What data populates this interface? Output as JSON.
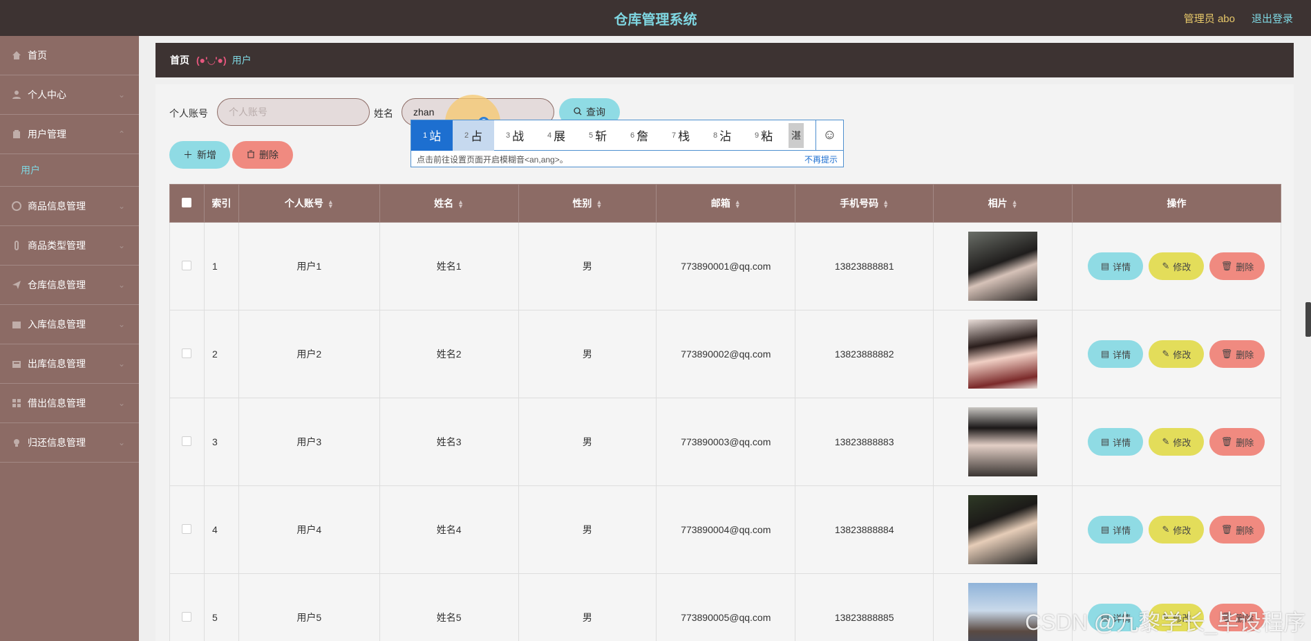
{
  "header": {
    "title": "仓库管理系统",
    "admin": "管理员 abo",
    "logout": "退出登录"
  },
  "sidebar": {
    "items": [
      {
        "label": "首页",
        "icon": "home-icon"
      },
      {
        "label": "个人中心",
        "icon": "user-icon"
      },
      {
        "label": "用户管理",
        "icon": "building-icon"
      },
      {
        "label": "商品信息管理",
        "icon": "tag-icon"
      },
      {
        "label": "商品类型管理",
        "icon": "clip-icon"
      },
      {
        "label": "仓库信息管理",
        "icon": "send-icon"
      },
      {
        "label": "入库信息管理",
        "icon": "box-icon"
      },
      {
        "label": "出库信息管理",
        "icon": "box-out-icon"
      },
      {
        "label": "借出信息管理",
        "icon": "grid-icon"
      },
      {
        "label": "归还信息管理",
        "icon": "bulb-icon"
      }
    ],
    "sub_active": "用户"
  },
  "breadcrumb": {
    "home": "首页",
    "face": "(●'◡'●)",
    "current": "用户"
  },
  "search": {
    "account_label": "个人账号",
    "account_placeholder": "个人账号",
    "name_label": "姓名",
    "name_value": "zhan",
    "query_button": "查询"
  },
  "actions": {
    "add": "新增",
    "delete": "删除"
  },
  "ime": {
    "candidates": [
      {
        "n": "1",
        "t": "站"
      },
      {
        "n": "2",
        "t": "占"
      },
      {
        "n": "3",
        "t": "战"
      },
      {
        "n": "4",
        "t": "展"
      },
      {
        "n": "5",
        "t": "斩"
      },
      {
        "n": "6",
        "t": "詹"
      },
      {
        "n": "7",
        "t": "栈"
      },
      {
        "n": "8",
        "t": "沾"
      },
      {
        "n": "9",
        "t": "粘"
      }
    ],
    "more": "湛",
    "tip": "点击前往设置页面开启模糊音<an,ang>。",
    "no_show": "不再提示"
  },
  "table": {
    "columns": [
      "索引",
      "个人账号",
      "姓名",
      "性别",
      "邮箱",
      "手机号码",
      "相片",
      "操作"
    ],
    "rows": [
      {
        "index": "1",
        "account": "用户1",
        "name": "姓名1",
        "gender": "男",
        "email": "773890001@qq.com",
        "phone": "13823888881"
      },
      {
        "index": "2",
        "account": "用户2",
        "name": "姓名2",
        "gender": "男",
        "email": "773890002@qq.com",
        "phone": "13823888882"
      },
      {
        "index": "3",
        "account": "用户3",
        "name": "姓名3",
        "gender": "男",
        "email": "773890003@qq.com",
        "phone": "13823888883"
      },
      {
        "index": "4",
        "account": "用户4",
        "name": "姓名4",
        "gender": "男",
        "email": "773890004@qq.com",
        "phone": "13823888884"
      },
      {
        "index": "5",
        "account": "用户5",
        "name": "姓名5",
        "gender": "男",
        "email": "773890005@qq.com",
        "phone": "13823888885"
      }
    ],
    "ops": {
      "detail": "详情",
      "edit": "修改",
      "delete": "删除"
    }
  },
  "watermark": "CSDN @九黎学长_毕设程序",
  "colors": {
    "topbar": "#3d3332",
    "sidebar": "#8c6b65",
    "accent_cyan": "#8fdbe4",
    "accent_yellow": "#e3dd5a",
    "accent_red": "#f08a80"
  }
}
